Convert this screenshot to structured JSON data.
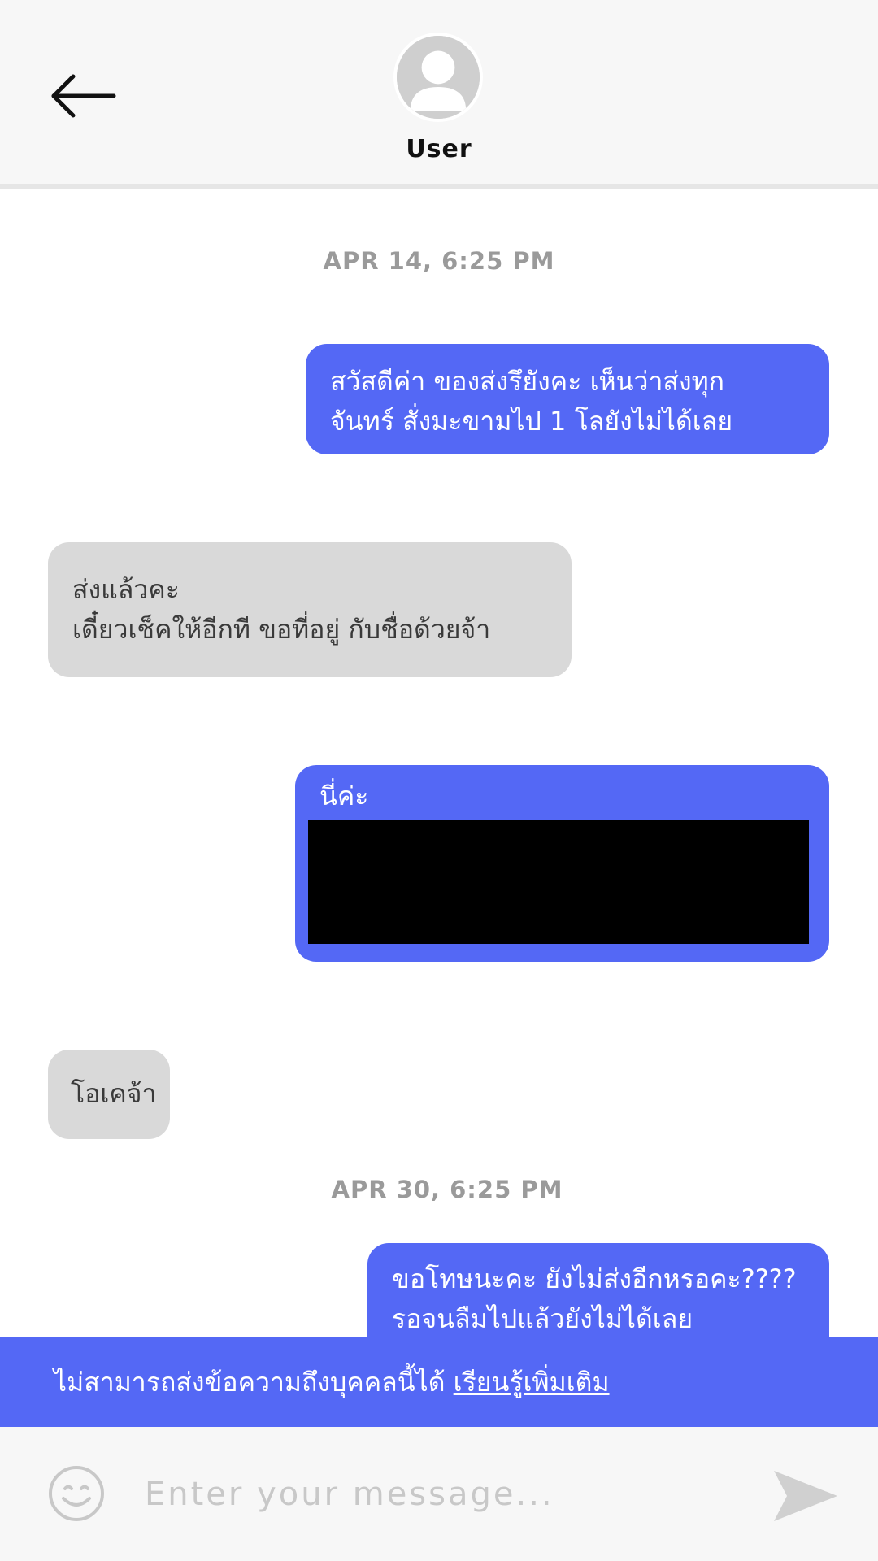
{
  "header": {
    "user_name": "User",
    "back_icon": "arrow-left-icon",
    "avatar_icon": "user-avatar-icon"
  },
  "conversation": {
    "timestamps": [
      "APR 14, 6:25 PM",
      "APR 30, 6:25 PM"
    ],
    "messages": [
      {
        "direction": "outgoing",
        "lines": [
          "สวัสดีค่า ของส่งรึยังคะ เห็นว่าส่งทุก",
          "จันทร์ สั่งมะขามไป 1 โลยังไม่ได้เลย"
        ]
      },
      {
        "direction": "incoming",
        "lines": [
          "ส่งแล้วคะ",
          "เดี๋ยวเช็คให้อีกที ขอที่อยู่ กับชื่อด้วยจ้า"
        ]
      },
      {
        "direction": "outgoing",
        "lines": [
          "นี่ค่ะ"
        ],
        "attachment": "redacted-image"
      },
      {
        "direction": "incoming",
        "lines": [
          "โอเคจ้า"
        ]
      },
      {
        "direction": "outgoing",
        "lines": [
          "ขอโทษนะคะ ยังไม่ส่งอีกหรอคะ????",
          "รอจนลืมไปแล้วยังไม่ได้เลย"
        ]
      }
    ]
  },
  "notice": {
    "text": "ไม่สามารถส่งข้อความถึงบุคคลนี้ได้ ",
    "link_label": "เรียนรู้เพิ่มเติม"
  },
  "composer": {
    "placeholder": "Enter your message...",
    "emoji_icon": "smiley-icon",
    "send_icon": "send-icon"
  },
  "colors": {
    "accent": "#5468f5",
    "incoming_bubble": "#d9d9d9",
    "header_bg": "#f7f7f7",
    "timestamp": "#9a9a9a"
  }
}
